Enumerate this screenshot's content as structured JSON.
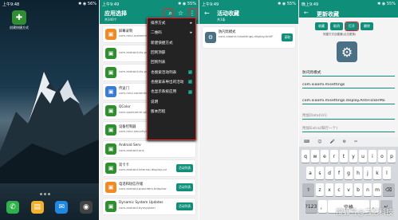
{
  "home": {
    "time": "上午9:48",
    "status_right": "✱ ◉ 56%",
    "shortcut_label": "创建快捷方式",
    "dock_icons": [
      "phone-icon",
      "notes-icon",
      "messages-icon",
      "camera-icon"
    ]
  },
  "app_list": {
    "time": "上午9:49",
    "status_right": "✱ ◉ 55%",
    "title": "应用选择",
    "subtitle": "共340个",
    "apps": [
      {
        "name": "屏幕录制",
        "pkg": "com.miui.screenrecorder",
        "color": "#f08a24",
        "btn": ""
      },
      {
        "name": "",
        "pkg": "com.android.cts.priv.ctsshim",
        "color": "#2e8f2e",
        "btn": ""
      },
      {
        "name": "",
        "pkg": "com.android.cts.priv",
        "color": "#2e8f2e",
        "btn": ""
      },
      {
        "name": "传送门",
        "pkg": "com.miui.contentextension",
        "color": "#3a7bd5",
        "btn": ""
      },
      {
        "name": "QColor",
        "pkg": "com.qualcomm.qti.qcolor",
        "color": "#2e8f2e",
        "btn": ""
      },
      {
        "name": "设备控制器",
        "pkg": "com.miui.securityinputmethod",
        "color": "#2e8f2e",
        "btn": ""
      },
      {
        "name": "Android Serv",
        "pkg": "com.android.ons",
        "color": "#2e8f2e",
        "btn": ""
      },
      {
        "name": "双卡卡",
        "pkg": "com.android.internal.display.cutout.emulation.double",
        "color": "#2e8f2e",
        "btn": "活动列表"
      },
      {
        "name": "电话和短信存储",
        "pkg": "com.android.providers.telephony",
        "color": "#f08a24",
        "btn": "活动列表"
      },
      {
        "name": "Dynamic System Updates",
        "pkg": "com.android.dynsystem",
        "color": "#2e8f2e",
        "btn": "活动列表"
      }
    ],
    "menu": [
      {
        "label": "排序方式",
        "kind": "arrow"
      },
      {
        "label": "二维码",
        "kind": "arrow"
      },
      {
        "label": "新建快捷方式",
        "kind": ""
      },
      {
        "label": "回到顶部",
        "kind": ""
      },
      {
        "label": "回到列表",
        "kind": ""
      },
      {
        "label": "也搜索活动列表",
        "kind": "check"
      },
      {
        "label": "也搜索未导出的活动",
        "kind": "check"
      },
      {
        "label": "也显示系统应用",
        "kind": "check"
      },
      {
        "label": "说明",
        "kind": ""
      },
      {
        "label": "版本历程",
        "kind": ""
      }
    ]
  },
  "activities": {
    "time": "上午9:49",
    "status_right": "✱ ◉ 55%",
    "title": "活动收藏",
    "subtitle": "共1条",
    "item_name": "防闪烁模式",
    "item_pkg": "com.xiaomi.misettings.display.AntiFlickerMode.AntiFlickerActivity",
    "item_btn": "读取"
  },
  "update": {
    "time": "晚上9:49",
    "status_right": "✱ ◉ 55%",
    "title": "更新收藏",
    "buttons": [
      "收藏",
      "取消",
      "打开",
      "删除"
    ],
    "hint": "快捷方式创建器(点击更换)",
    "fields": [
      {
        "label": "",
        "value": "防闪烁模式"
      },
      {
        "label": "",
        "value": "com.xiaomi.misettings"
      },
      {
        "label": "",
        "value": "com.xiaomi.misettings.display.AntiFlickerMo"
      },
      {
        "label": "",
        "value": "附加Data(Uri)"
      },
      {
        "label": "",
        "value": "附加Extra(每行一个)"
      }
    ],
    "candidates": [
      "⌨",
      "☺",
      "🎤",
      "⚙",
      "✂"
    ],
    "keys_row1": [
      "q",
      "w",
      "e",
      "r",
      "t",
      "y",
      "u",
      "i",
      "o",
      "p"
    ],
    "keys_row2": [
      "a",
      "s",
      "d",
      "f",
      "g",
      "h",
      "j",
      "k",
      "l"
    ],
    "keys_row3": [
      "z",
      "x",
      "c",
      "v",
      "b",
      "n",
      "m"
    ],
    "keys_row4": [
      "?123",
      "，",
      "空格",
      "。",
      "↵"
    ]
  },
  "watermark": "搜狐号@三亿科技"
}
